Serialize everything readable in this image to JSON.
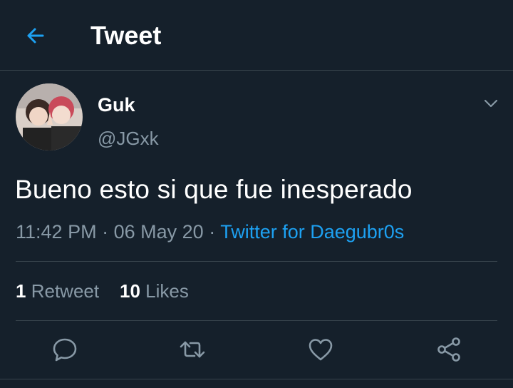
{
  "header": {
    "title": "Tweet",
    "back_icon": "arrow-left-icon",
    "accent": "#1da1f2"
  },
  "tweet": {
    "name": "Guk",
    "handle": "@JGxk",
    "text": "Bueno esto si que fue inesperado",
    "time": "11:42 PM",
    "date": "06 May 20",
    "source": "Twitter for Daegubr0s"
  },
  "stats": {
    "retweets_count": "1",
    "retweets_label": "Retweet",
    "likes_count": "10",
    "likes_label": "Likes"
  },
  "actions": [
    "reply-icon",
    "retweet-icon",
    "like-icon",
    "share-icon"
  ]
}
